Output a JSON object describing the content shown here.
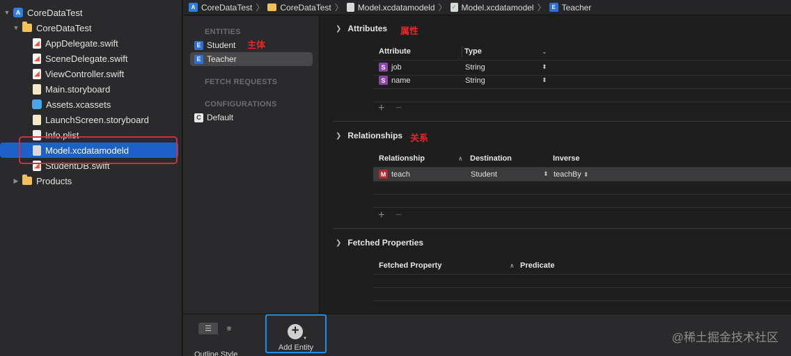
{
  "navigator": {
    "items": [
      {
        "label": "CoreDataTest",
        "icon": "xcode-project-icon",
        "expanded": true
      },
      {
        "label": "CoreDataTest",
        "icon": "folder-icon",
        "expanded": true
      },
      {
        "label": "AppDelegate.swift",
        "icon": "swift-file-icon"
      },
      {
        "label": "SceneDelegate.swift",
        "icon": "swift-file-icon"
      },
      {
        "label": "ViewController.swift",
        "icon": "swift-file-icon"
      },
      {
        "label": "Main.storyboard",
        "icon": "storyboard-file-icon"
      },
      {
        "label": "Assets.xcassets",
        "icon": "asset-catalog-icon"
      },
      {
        "label": "LaunchScreen.storyboard",
        "icon": "storyboard-file-icon"
      },
      {
        "label": "Info.plist",
        "icon": "plist-file-icon"
      },
      {
        "label": "Model.xcdatamodeld",
        "icon": "data-model-file-icon",
        "selected": true
      },
      {
        "label": "StudentDB.swift",
        "icon": "swift-file-icon"
      },
      {
        "label": "Products",
        "icon": "folder-icon",
        "expanded": false
      }
    ]
  },
  "jumpbar": {
    "crumbs": [
      "CoreDataTest",
      "CoreDataTest",
      "Model.xcdatamodeld",
      "Model.xcdatamodel",
      "Teacher"
    ]
  },
  "entities_pane": {
    "entities_title": "ENTITIES",
    "entities": [
      "Student",
      "Teacher"
    ],
    "entities_annotation": "主体",
    "fetch_requests_title": "FETCH REQUESTS",
    "configurations_title": "CONFIGURATIONS",
    "configurations": [
      "Default"
    ]
  },
  "editor": {
    "attributes": {
      "title": "Attributes",
      "annotation": "属性",
      "col_attribute": "Attribute",
      "col_type": "Type",
      "rows": [
        {
          "badge": "S",
          "name": "job",
          "type": "String"
        },
        {
          "badge": "S",
          "name": "name",
          "type": "String"
        }
      ]
    },
    "relationships": {
      "title": "Relationships",
      "annotation": "关系",
      "col_relationship": "Relationship",
      "col_destination": "Destination",
      "col_inverse": "Inverse",
      "rows": [
        {
          "badge": "M",
          "name": "teach",
          "destination": "Student",
          "inverse": "teachBy"
        }
      ]
    },
    "fetched_properties": {
      "title": "Fetched Properties",
      "col_fetched_property": "Fetched Property",
      "col_predicate": "Predicate"
    },
    "plus": "+",
    "minus": "−"
  },
  "bottombar": {
    "outline_style_label": "Outline Style",
    "add_entity_label": "Add Entity"
  },
  "watermark": "@稀土掘金技术社区",
  "colors": {
    "selection_blue": "#1f5fc8",
    "annotation_red": "#e8262b",
    "highlight_box_blue": "#1f8fe3"
  }
}
